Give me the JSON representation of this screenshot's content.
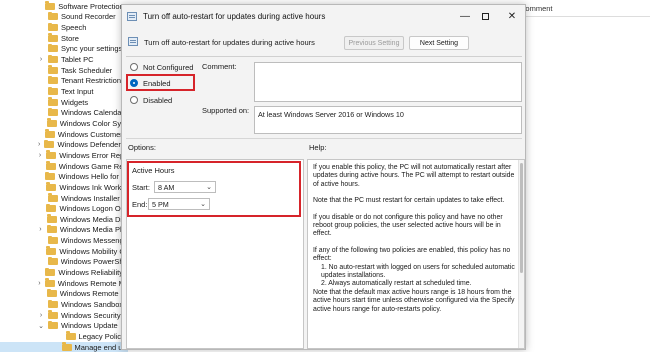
{
  "tree": {
    "items": [
      {
        "label": "Software Protection Platform",
        "expandable": false
      },
      {
        "label": "Sound Recorder",
        "expandable": false
      },
      {
        "label": "Speech",
        "expandable": false
      },
      {
        "label": "Store",
        "expandable": false
      },
      {
        "label": "Sync your settings",
        "expandable": false
      },
      {
        "label": "Tablet PC",
        "expandable": true
      },
      {
        "label": "Task Scheduler",
        "expandable": false
      },
      {
        "label": "Tenant Restrictions",
        "expandable": false
      },
      {
        "label": "Text Input",
        "expandable": false
      },
      {
        "label": "Widgets",
        "expandable": false
      },
      {
        "label": "Windows Calendar",
        "expandable": false
      },
      {
        "label": "Windows Color System",
        "expandable": false
      },
      {
        "label": "Windows Customer Experience",
        "expandable": false
      },
      {
        "label": "Windows Defender SmartScreen",
        "expandable": true
      },
      {
        "label": "Windows Error Reporting",
        "expandable": true
      },
      {
        "label": "Windows Game Recording",
        "expandable": false
      },
      {
        "label": "Windows Hello for Business",
        "expandable": false
      },
      {
        "label": "Windows Ink Workspace",
        "expandable": false
      },
      {
        "label": "Windows Installer",
        "expandable": false
      },
      {
        "label": "Windows Logon Options",
        "expandable": false
      },
      {
        "label": "Windows Media Digital",
        "expandable": false
      },
      {
        "label": "Windows Media Player",
        "expandable": true
      },
      {
        "label": "Windows Messenger",
        "expandable": false
      },
      {
        "label": "Windows Mobility Center",
        "expandable": false
      },
      {
        "label": "Windows PowerShell",
        "expandable": false
      },
      {
        "label": "Windows Reliability Analysis",
        "expandable": false
      },
      {
        "label": "Windows Remote Management",
        "expandable": true
      },
      {
        "label": "Windows Remote Shell",
        "expandable": false
      },
      {
        "label": "Windows Sandbox",
        "expandable": false
      },
      {
        "label": "Windows Security",
        "expandable": true
      },
      {
        "label": "Windows Update",
        "expandable": true,
        "expanded": true
      },
      {
        "label": "Legacy Policies",
        "expandable": false,
        "child": true
      },
      {
        "label": "Manage end user experience",
        "expandable": false,
        "child": true,
        "selected": true
      }
    ]
  },
  "right_pane": {
    "header": "Comment"
  },
  "dialog": {
    "title": "Turn off auto-restart for updates during active hours",
    "policy_name": "Turn off auto-restart for updates during active hours",
    "prev_button": "Previous Setting",
    "next_button": "Next Setting",
    "radio_not_configured": "Not Configured",
    "radio_enabled": "Enabled",
    "radio_disabled": "Disabled",
    "selected_state": "Enabled",
    "comment_label": "Comment:",
    "supported_label": "Supported on:",
    "supported_value": "At least Windows Server 2016 or Windows 10",
    "options_label": "Options:",
    "help_label": "Help:",
    "active_hours_label": "Active Hours",
    "start_label": "Start:",
    "start_value": "8 AM",
    "end_label": "End:",
    "end_value": "5 PM",
    "help_paragraphs": [
      "If you enable this policy, the PC will not automatically restart after updates during active hours. The PC will attempt to restart outside of active hours.",
      "Note that the PC must restart for certain updates to take effect.",
      "If you disable or do not configure this policy and have no other reboot group policies, the user selected active hours will be in effect.",
      "If any of the following two policies are enabled, this policy has no effect:"
    ],
    "help_list": [
      "1. No auto-restart with logged on users for scheduled automatic updates installations.",
      "2. Always automatically restart at scheduled time."
    ],
    "help_note": "Note that the default max active hours range is 18 hours from the active hours start time unless otherwise configured via the Specify active hours range for auto-restarts policy."
  },
  "colors": {
    "highlight_box": "#d6242a",
    "accent": "#0067c0",
    "folder": "#e8b84a"
  }
}
